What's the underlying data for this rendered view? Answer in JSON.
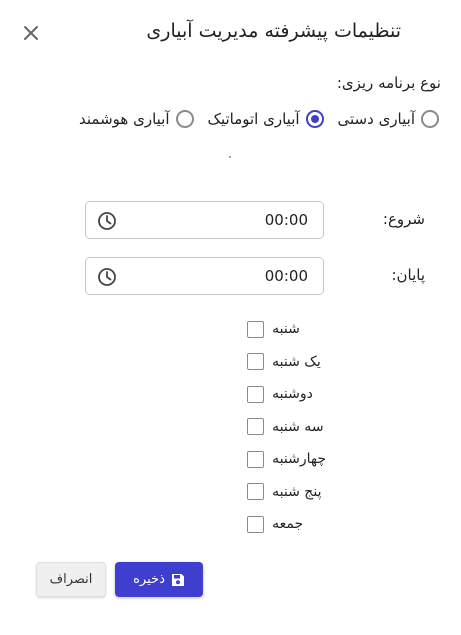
{
  "dialog": {
    "title": "تنظیمات پیشرفته مدیریت آبیاری"
  },
  "schedule_type": {
    "label": "نوع برنامه ریزی:",
    "options": [
      {
        "label": "آبیاری دستی",
        "selected": false
      },
      {
        "label": "آبیاری اتوماتیک",
        "selected": true
      },
      {
        "label": "آبیاری هوشمند",
        "selected": false
      }
    ]
  },
  "start": {
    "label": "شروع:",
    "value": "00:00"
  },
  "end": {
    "label": "پایان:",
    "value": "00:00"
  },
  "days": [
    {
      "label": "شنبه",
      "checked": false
    },
    {
      "label": "یک شنبه",
      "checked": false
    },
    {
      "label": "دوشنبه",
      "checked": false
    },
    {
      "label": "سه شنبه",
      "checked": false
    },
    {
      "label": "چهارشنبه",
      "checked": false
    },
    {
      "label": "پنج شنبه",
      "checked": false
    },
    {
      "label": "جمعه",
      "checked": false
    }
  ],
  "buttons": {
    "save_label": "ذخیره",
    "cancel_label": "انصراف"
  },
  "icons": {
    "close": "close-icon",
    "clock": "clock-icon",
    "save": "floppy-disk-icon"
  },
  "colors": {
    "accent": "#3f3fcf",
    "radio_checked": "#3f3fbf"
  }
}
